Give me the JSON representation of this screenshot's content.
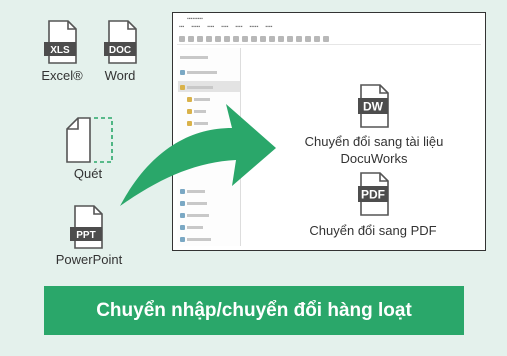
{
  "sources": [
    {
      "badge": "XLS",
      "label": "Excel®",
      "icon": "xls-file-icon"
    },
    {
      "badge": "DOC",
      "label": "Word",
      "icon": "doc-file-icon"
    },
    {
      "badge": "",
      "label": "Quét",
      "icon": "scan-document-icon"
    },
    {
      "badge": "PPT",
      "label": "PowerPoint",
      "icon": "ppt-file-icon"
    }
  ],
  "targets": [
    {
      "badge": "DW",
      "label_line1": "Chuyển đổi sang tài liệu",
      "label_line2": "DocuWorks",
      "icon": "docuworks-file-icon"
    },
    {
      "badge": "PDF",
      "label_line1": "Chuyển đổi sang PDF",
      "icon": "pdf-file-icon"
    }
  ],
  "banner": {
    "text": "Chuyển nhập/chuyển đổi hàng loạt"
  },
  "colors": {
    "accent": "#2aa76a",
    "background": "#e4f1ec",
    "icon_badge": "#4d4d4d",
    "scan_dash": "#2aa76a"
  }
}
